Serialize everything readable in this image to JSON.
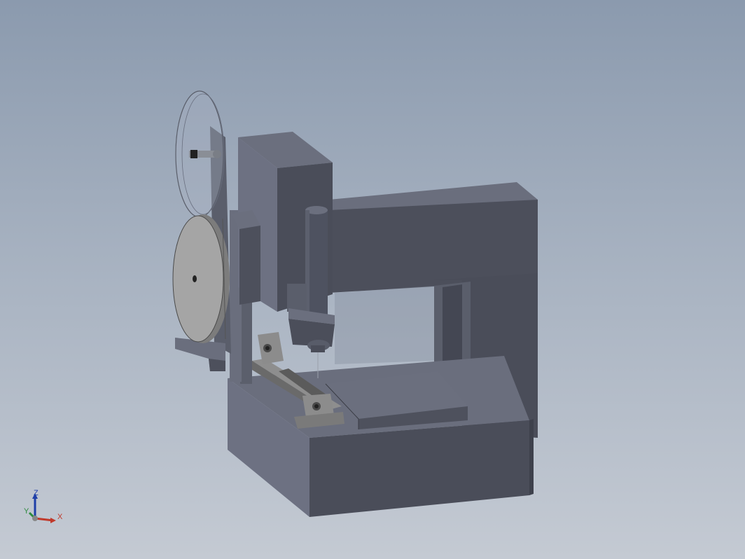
{
  "colors": {
    "background_top": "#8b9aae",
    "background_bottom": "#c4cad3",
    "body_front": "#4a4d59",
    "body_light": "#6f7384",
    "body_mid": "#5b5f6c",
    "spool_face": "#a5a5a5",
    "spool_rim": "#7c7c7c",
    "axis_x": "#c0392b",
    "axis_y": "#2e8b3e",
    "axis_z": "#1f3fa8"
  },
  "orientation_triad": {
    "x_label": "X",
    "y_label": "Y",
    "z_label": "Z"
  }
}
